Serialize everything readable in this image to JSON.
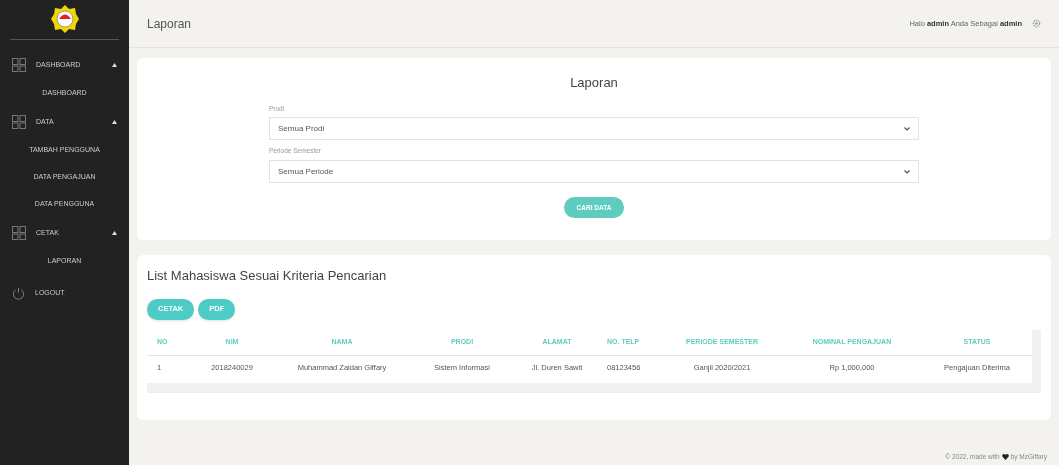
{
  "sidebar": {
    "groups": [
      {
        "label": "DASHBOARD",
        "expanded": true,
        "items": [
          "DASHBOARD"
        ]
      },
      {
        "label": "DATA",
        "expanded": true,
        "items": [
          "TAMBAH PENGGUNA",
          "DATA PENGAJUAN",
          "DATA PENGGUNA"
        ]
      },
      {
        "label": "CETAK",
        "expanded": true,
        "items": [
          "LAPORAN"
        ]
      }
    ],
    "logout": "LOGOUT"
  },
  "header": {
    "title": "Laporan",
    "greeting": "Halo **admin** Anda Sebagai **admin**"
  },
  "filter_card": {
    "title": "Laporan",
    "fields": [
      {
        "label": "Prodi",
        "value": "Semua Prodi"
      },
      {
        "label": "Periode Semester",
        "value": "Semua Periode"
      }
    ],
    "button": "CARI DATA"
  },
  "results": {
    "title": "List Mahasiswa Sesuai Kriteria Pencarian",
    "buttons": [
      "CETAK",
      "PDF"
    ],
    "table": {
      "columns": [
        "NO",
        "NIM",
        "NAMA",
        "PRODI",
        "ALAMAT",
        "NO. TELP",
        "PERIODE SEMESTER",
        "NOMINAL PENGAJUAN",
        "STATUS"
      ],
      "rows": [
        [
          "1",
          "2018240029",
          "Muhammad Zaidan Giffary",
          "Sistem Informasi",
          "Jl. Duren Sawit",
          "08123456",
          "Ganjil 2020/2021",
          "Rp 1,000,000",
          "Pengajuan Diterima"
        ]
      ]
    }
  },
  "footer": {
    "before": "© 2022, made with",
    "after": "by MzGiffary"
  }
}
